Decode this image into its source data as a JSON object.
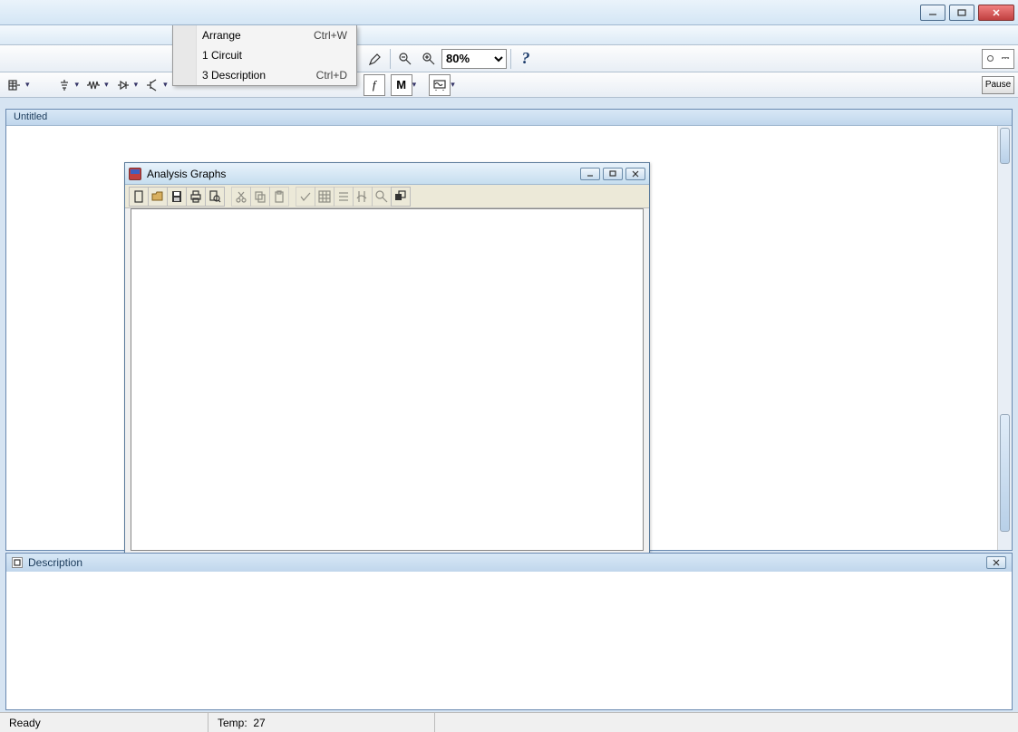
{
  "window": {
    "min_tip": "Minimize",
    "max_tip": "Maximize",
    "close_tip": "Close"
  },
  "menu": {
    "items": [
      {
        "label": "Arrange",
        "shortcut": "Ctrl+W"
      },
      {
        "label": "1 Circuit",
        "shortcut": ""
      },
      {
        "label": "3 Description",
        "shortcut": "Ctrl+D"
      }
    ]
  },
  "toolbar": {
    "zoom_value": "80%",
    "help_label": "?",
    "pause_label": "Pause",
    "m_label": "M",
    "f_label": "f"
  },
  "mdi": {
    "doc_title": "Untitled"
  },
  "child": {
    "title": "Analysis Graphs"
  },
  "description": {
    "title": "Description"
  },
  "status": {
    "ready": "Ready",
    "temp_label": "Temp:",
    "temp_value": "27"
  }
}
